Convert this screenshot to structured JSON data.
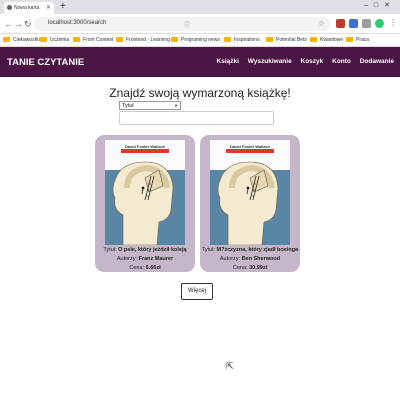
{
  "browser": {
    "tab_title": "Nowa karta",
    "url": "localhost:3000/search",
    "bookmarks": [
      "Ciekawostki",
      "Uczelnia",
      "Front Content",
      "Frontend - Learning",
      "Programing news",
      "Inspirations",
      "Potential Bets",
      "Kwantowe",
      "Praca"
    ]
  },
  "navbar": {
    "brand": "TANIE CZYTANIE",
    "links": [
      "Książki",
      "Wyszukiwanie",
      "Koszyk",
      "Konto",
      "Dodawanie"
    ]
  },
  "search": {
    "heading": "Znajdź swoją wymarzoną książkę!",
    "filter_selected": "Tytuł",
    "query": ""
  },
  "books": [
    {
      "cover_author": "David Foster Wallace",
      "title_label": "Tytuł:",
      "title": "O psie, który jeździł koleją",
      "author_label": "Autorzy:",
      "author": "Franz Maurer",
      "price_label": "Cena:",
      "price": "6.66zł"
    },
    {
      "cover_author": "David Foster Wallace",
      "title_label": "Tytuł:",
      "title": "M?żczyzna, który zjadł boeinga",
      "author_label": "Autorzy:",
      "author": "Ben Sherwood",
      "price_label": "Cena:",
      "price": "30.99zł"
    }
  ],
  "more_button": "Więcej",
  "colors": {
    "navbar": "#4a1444",
    "card": "#c5b6ca",
    "cover": "#5a86a6"
  }
}
